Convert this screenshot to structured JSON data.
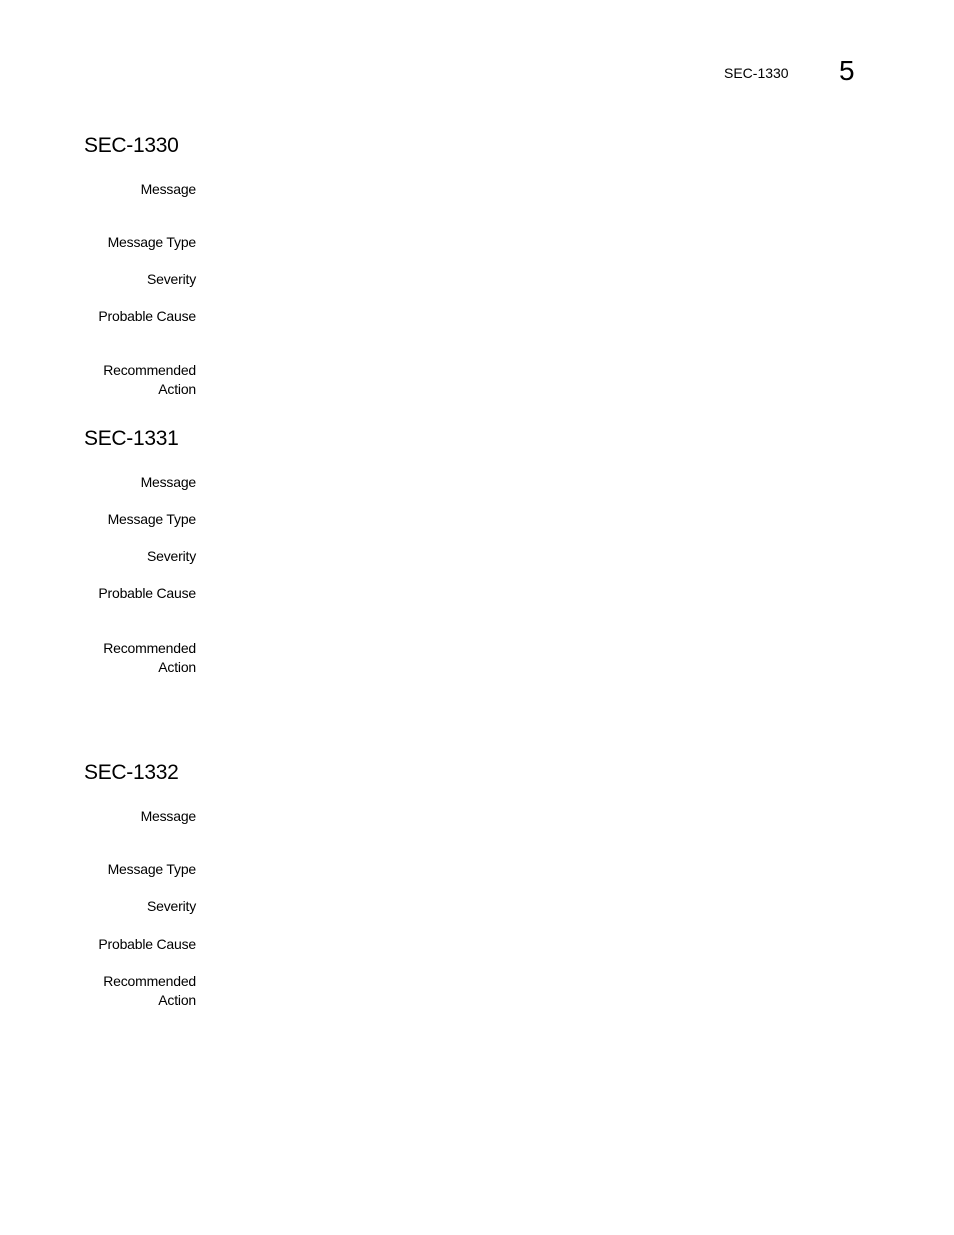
{
  "header": {
    "running_title": "SEC-1330",
    "chapter_number": "5"
  },
  "sections": [
    {
      "id": "SEC-1330",
      "fields": {
        "message_label": "Message",
        "message_value": "",
        "message_type_label": "Message Type",
        "message_type_value": "",
        "severity_label": "Severity",
        "severity_value": "",
        "probable_cause_label": "Probable Cause",
        "probable_cause_value": "",
        "recommended_action_label_1": "Recommended",
        "recommended_action_label_2": "Action",
        "recommended_action_value": ""
      }
    },
    {
      "id": "SEC-1331",
      "fields": {
        "message_label": "Message",
        "message_value": "",
        "message_type_label": "Message Type",
        "message_type_value": "",
        "severity_label": "Severity",
        "severity_value": "",
        "probable_cause_label": "Probable Cause",
        "probable_cause_value": "",
        "recommended_action_label_1": "Recommended",
        "recommended_action_label_2": "Action",
        "recommended_action_value": ""
      }
    },
    {
      "id": "SEC-1332",
      "fields": {
        "message_label": "Message",
        "message_value": "",
        "message_type_label": "Message Type",
        "message_type_value": "",
        "severity_label": "Severity",
        "severity_value": "",
        "probable_cause_label": "Probable Cause",
        "probable_cause_value": "",
        "recommended_action_label_1": "Recommended",
        "recommended_action_label_2": "Action",
        "recommended_action_value": ""
      }
    }
  ]
}
